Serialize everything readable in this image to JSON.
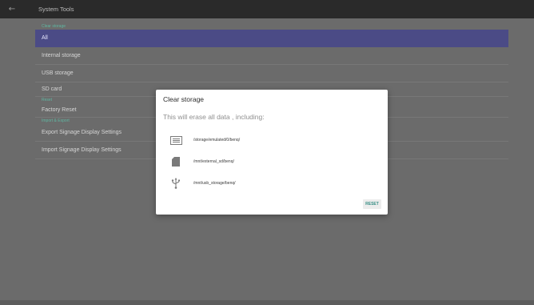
{
  "appbar": {
    "title": "System Tools",
    "back_icon": "←"
  },
  "list": {
    "clear_storage_header": "Clear storage",
    "items": [
      "All",
      "Internal storage",
      "USB storage",
      "SD card"
    ],
    "reset_header": "Reset",
    "factory_reset": "Factory Reset",
    "import_export_header": "Import & Export",
    "export_settings": "Export Signage Display Settings",
    "import_settings": "Import Signage Display Settings"
  },
  "dialog": {
    "title": "Clear storage",
    "message": "This will erase all data , including:",
    "paths": [
      {
        "icon": "storage-icon",
        "path": "/storage/emulated/0/benq/"
      },
      {
        "icon": "sd-card-icon",
        "path": "/mnt/external_sd/benq/"
      },
      {
        "icon": "usb-icon",
        "path": "/mnt/usb_storage/benq/"
      }
    ],
    "reset_label": "RESET"
  },
  "colors": {
    "accent": "#5fb7a2",
    "selection": "#4b4b86",
    "reset_text": "#3a8f86"
  }
}
